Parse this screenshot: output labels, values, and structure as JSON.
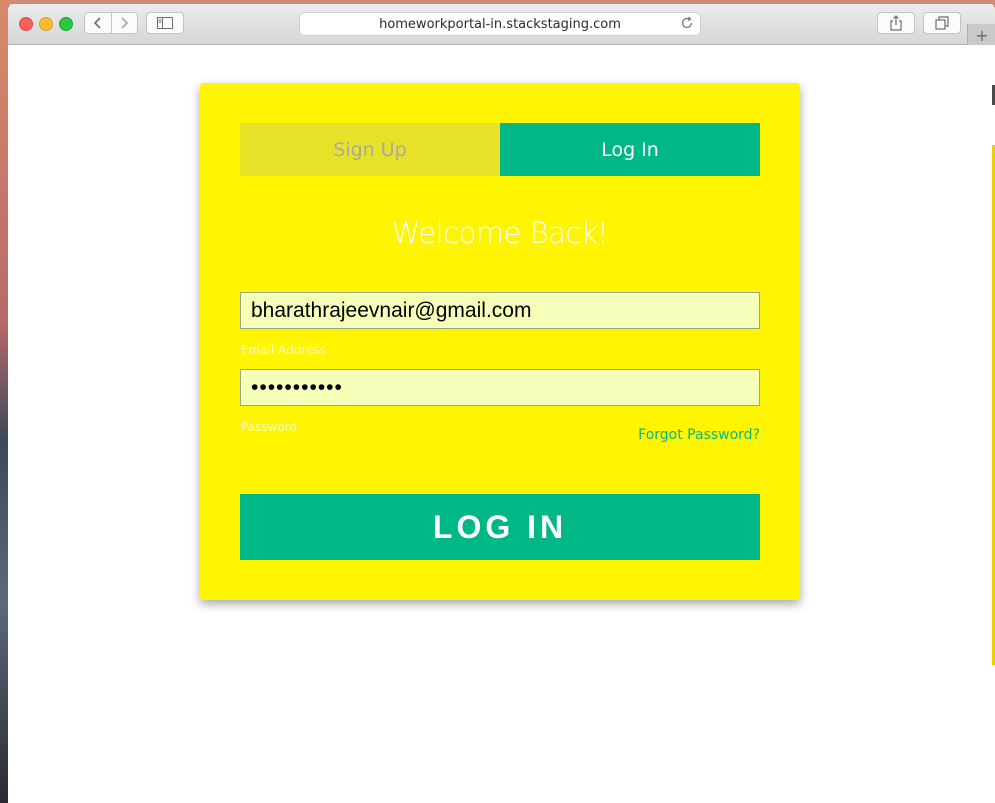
{
  "browser": {
    "url": "homeworkportal-in.stackstaging.com",
    "new_tab_symbol": "+",
    "icons": [
      "back-icon",
      "forward-icon",
      "sidebar-icon",
      "reload-icon",
      "share-icon",
      "tabs-icon"
    ]
  },
  "auth": {
    "tabs": [
      {
        "label": "Sign Up",
        "active": false
      },
      {
        "label": "Log In",
        "active": true
      }
    ],
    "heading": "Welcome Back!",
    "email": {
      "value": "bharathrajeevnair@gmail.com",
      "label": "Email Address"
    },
    "password": {
      "masked_value": "•••••••••••",
      "label": "Password"
    },
    "forgot_label": "Forgot Password?",
    "submit_label": "LOG IN"
  },
  "colors": {
    "card": "#fff500",
    "accent": "#00b887",
    "inactive_tab": "#e6e22a",
    "field_bg": "#f5ffb8"
  }
}
